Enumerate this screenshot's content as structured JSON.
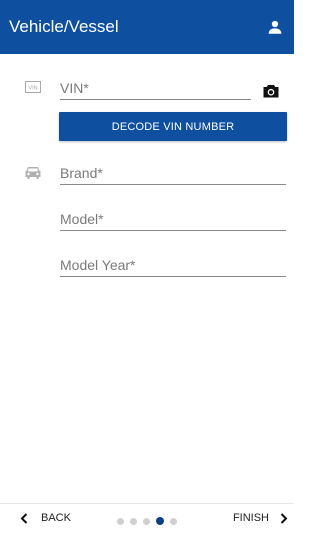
{
  "header": {
    "title": "Vehicle/Vessel",
    "profile_icon": "person-icon"
  },
  "colors": {
    "primary": "#0e4fa0",
    "active_dot": "#0e3f7e",
    "inactive_dot": "#cfcfcf"
  },
  "form": {
    "vin": {
      "placeholder": "VIN*",
      "value": "",
      "lead_icon": "vin-badge-icon",
      "trailing_icon": "camera-icon",
      "badge_text": "VIN"
    },
    "decode_button_label": "DECODE VIN NUMBER",
    "brand": {
      "placeholder": "Brand*",
      "value": "",
      "lead_icon": "car-icon"
    },
    "model": {
      "placeholder": "Model*",
      "value": ""
    },
    "model_year": {
      "placeholder": "Model Year*",
      "value": ""
    }
  },
  "footer": {
    "back_label": "BACK",
    "finish_label": "FINISH",
    "step_count": 5,
    "current_step": 4
  }
}
